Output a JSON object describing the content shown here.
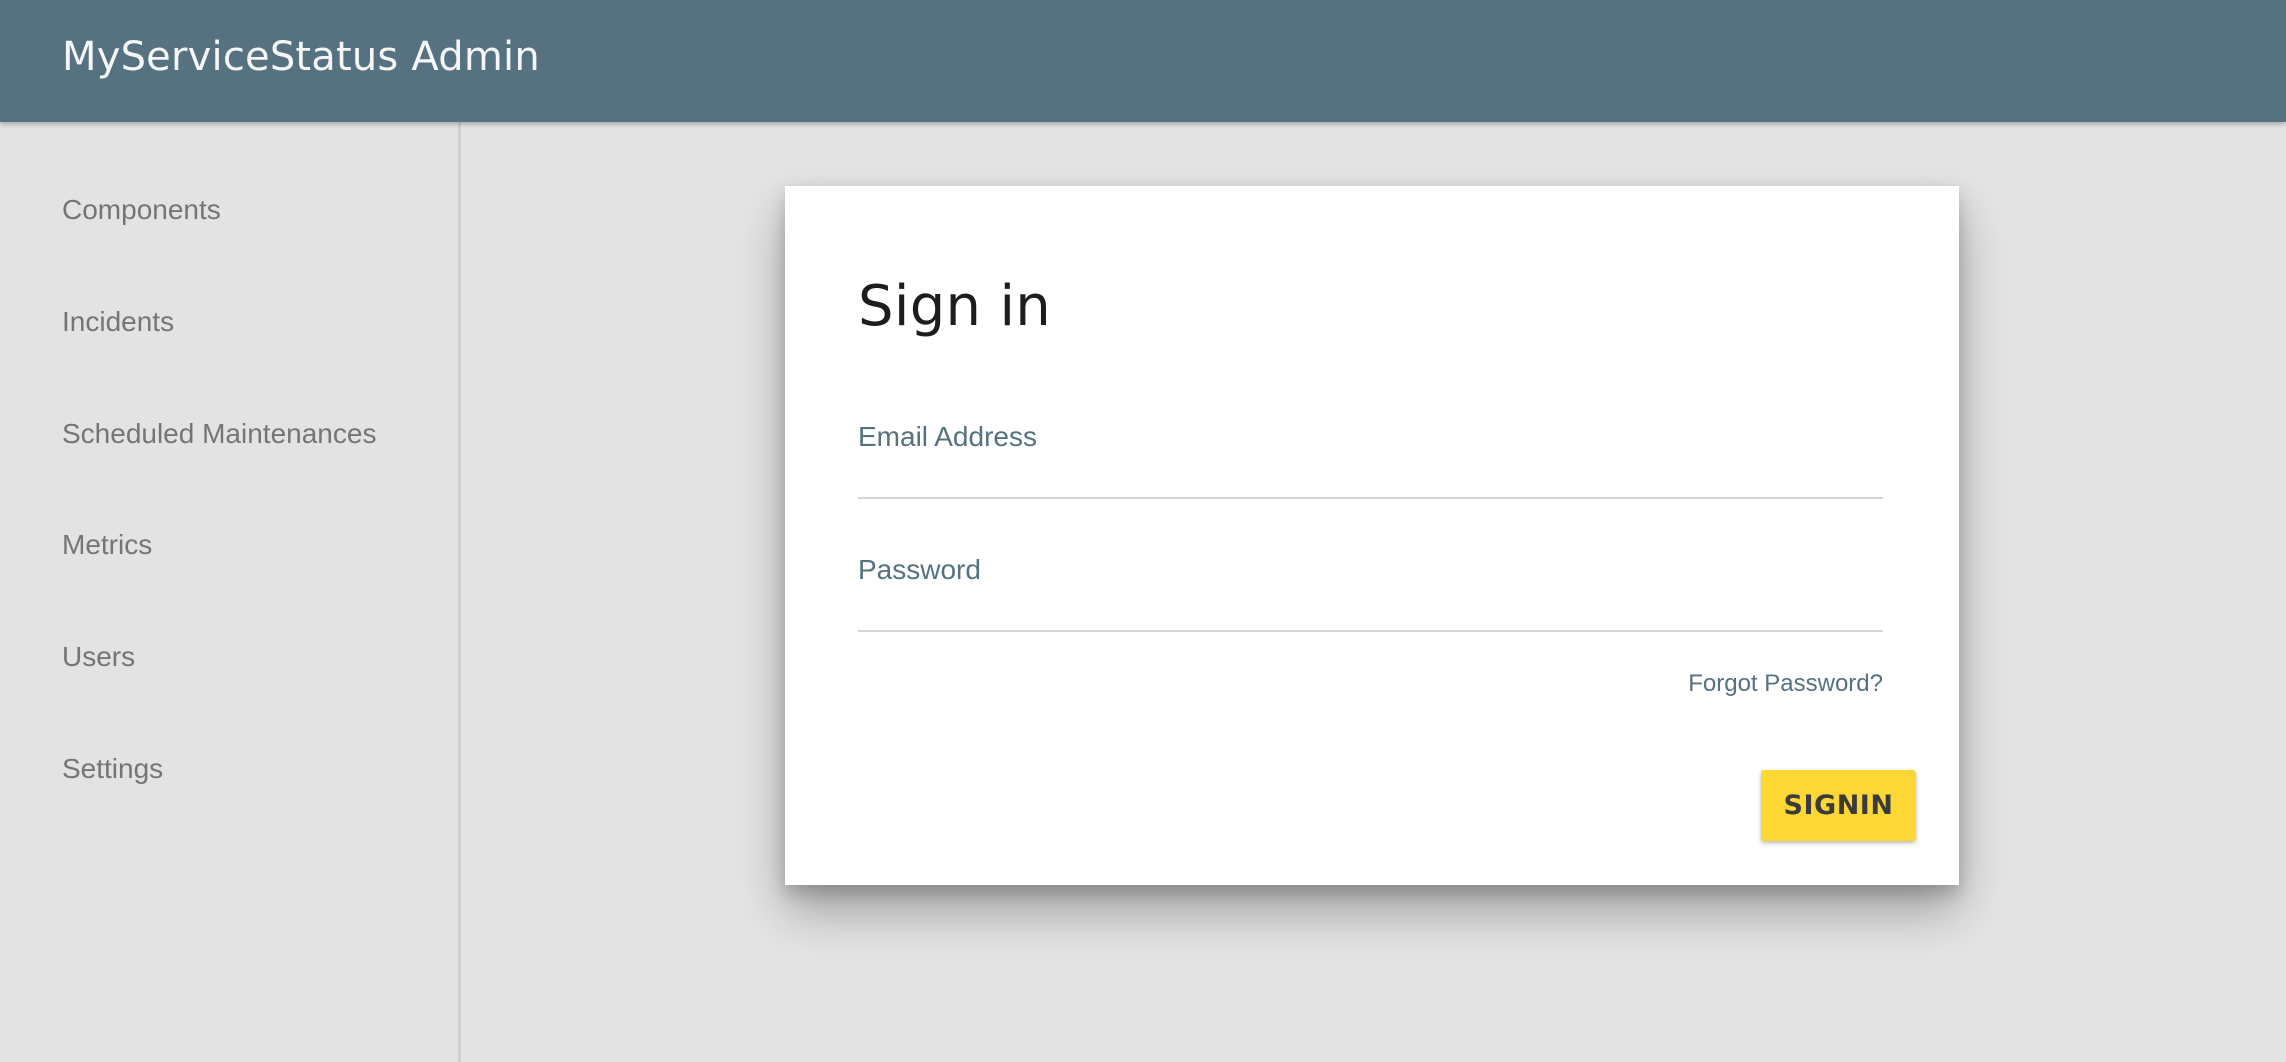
{
  "header": {
    "title": "MyServiceStatus Admin"
  },
  "sidebar": {
    "items": [
      {
        "label": "Components"
      },
      {
        "label": "Incidents"
      },
      {
        "label": "Scheduled Maintenances"
      },
      {
        "label": "Metrics"
      },
      {
        "label": "Users"
      },
      {
        "label": "Settings"
      }
    ]
  },
  "signin": {
    "title": "Sign in",
    "email_label": "Email Address",
    "email_value": "",
    "password_label": "Password",
    "password_value": "",
    "forgot_label": "Forgot Password?",
    "button_label": "SIGNIN"
  },
  "colors": {
    "header_bg": "#56717f",
    "button_bg": "#fdd835",
    "page_bg": "#e4e4e4"
  }
}
